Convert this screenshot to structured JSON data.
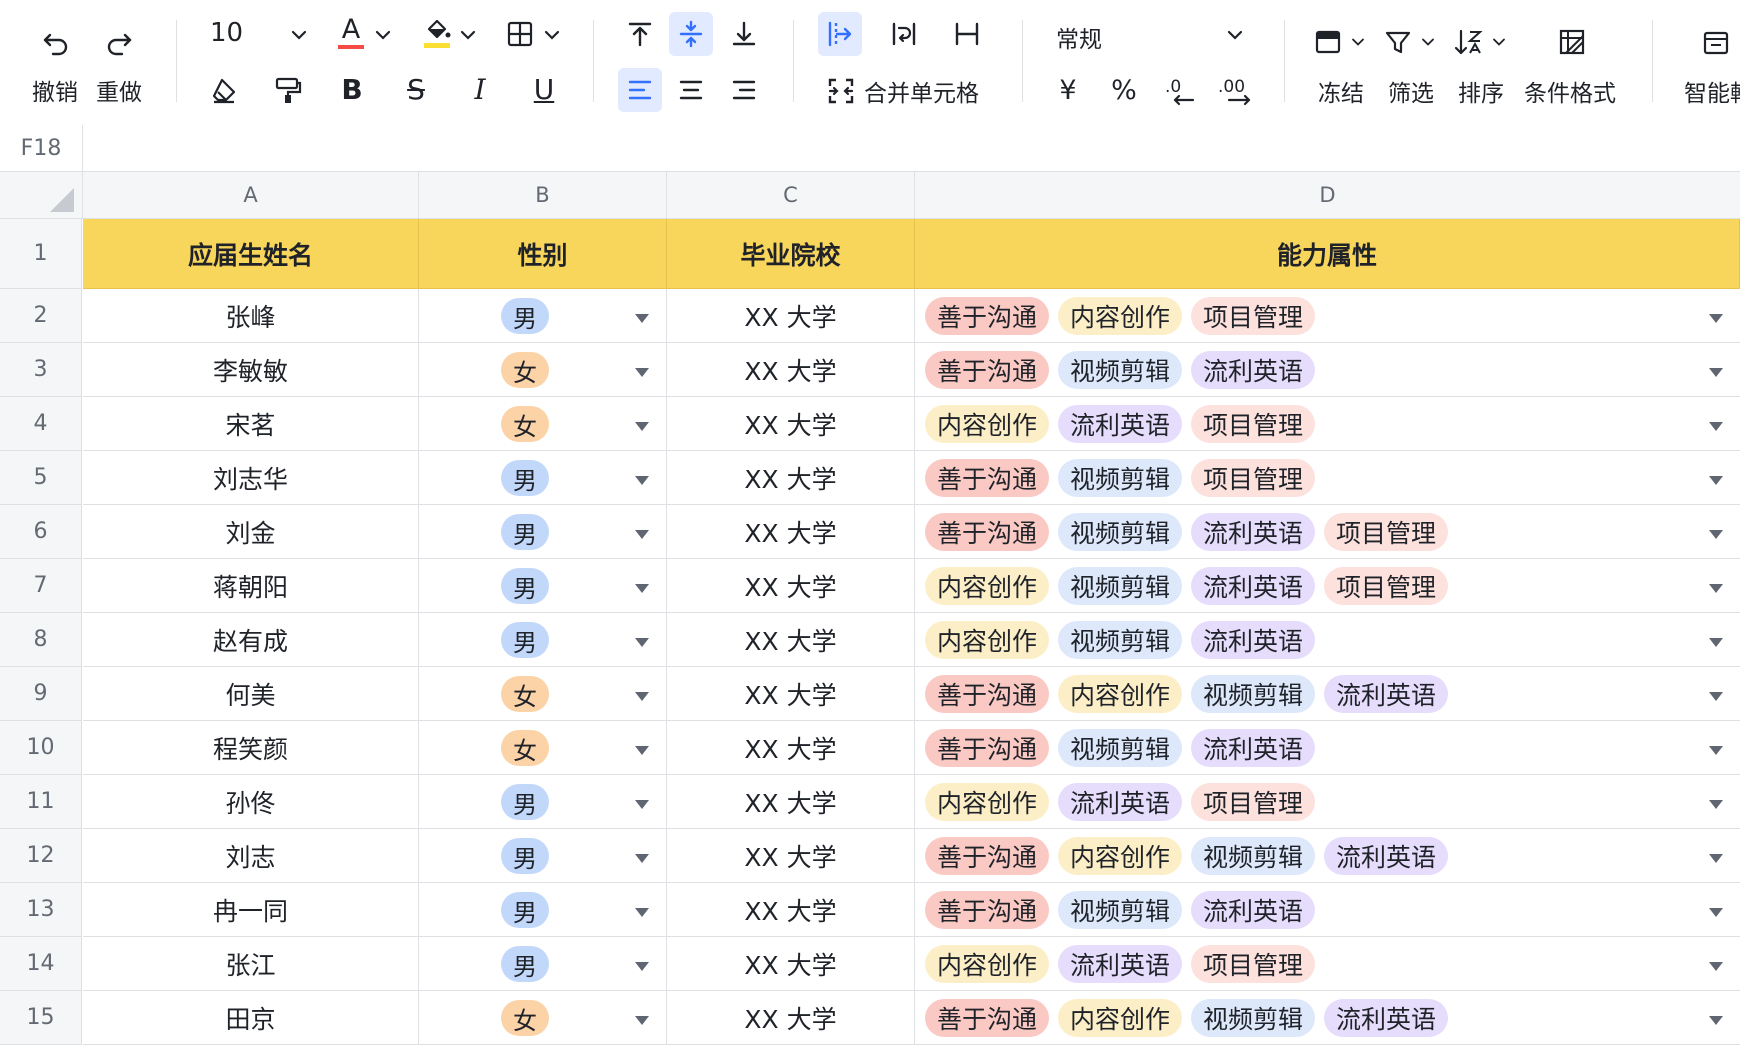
{
  "toolbar": {
    "undo_label": "撤销",
    "redo_label": "重做",
    "font_size": "10",
    "merge_label": "合并单元格",
    "number_format": "常规",
    "currency_symbol": "¥",
    "percent_symbol": "%",
    "freeze_label": "冻结",
    "filter_label": "筛选",
    "sort_label": "排序",
    "cond_format_label": "条件格式",
    "smart_label": "智能輔",
    "bold_glyph": "B",
    "italic_glyph": "I",
    "underline_glyph": "U",
    "strike_glyph": "S",
    "font_color_glyph": "A",
    "decimal_dec_glyph": ".0",
    "decimal_inc_glyph": ".00"
  },
  "name_box": "F18",
  "columns": [
    "A",
    "B",
    "C",
    "D"
  ],
  "header": [
    "应届生姓名",
    "性别",
    "毕业院校",
    "能力属性"
  ],
  "colors": {
    "header_bg": "#f8d55b",
    "male": "#c2d8fb",
    "female": "#fbd3a6",
    "tag_善于沟通": "#fbc9c3",
    "tag_内容创作": "#fcefc7",
    "tag_视频剪辑": "#dde8fb",
    "tag_流利英语": "#e6dcfb",
    "tag_项目管理": "#fce1dd",
    "accent": "#3370ff"
  },
  "rows": [
    {
      "num": "1"
    },
    {
      "num": "2",
      "name": "张峰",
      "gender": "男",
      "school": "XX 大学",
      "tags": [
        "善于沟通",
        "内容创作",
        "项目管理"
      ]
    },
    {
      "num": "3",
      "name": "李敏敏",
      "gender": "女",
      "school": "XX 大学",
      "tags": [
        "善于沟通",
        "视频剪辑",
        "流利英语"
      ]
    },
    {
      "num": "4",
      "name": "宋茗",
      "gender": "女",
      "school": "XX 大学",
      "tags": [
        "内容创作",
        "流利英语",
        "项目管理"
      ]
    },
    {
      "num": "5",
      "name": "刘志华",
      "gender": "男",
      "school": "XX 大学",
      "tags": [
        "善于沟通",
        "视频剪辑",
        "项目管理"
      ]
    },
    {
      "num": "6",
      "name": "刘金",
      "gender": "男",
      "school": "XX 大学",
      "tags": [
        "善于沟通",
        "视频剪辑",
        "流利英语",
        "项目管理"
      ]
    },
    {
      "num": "7",
      "name": "蒋朝阳",
      "gender": "男",
      "school": "XX 大学",
      "tags": [
        "内容创作",
        "视频剪辑",
        "流利英语",
        "项目管理"
      ]
    },
    {
      "num": "8",
      "name": "赵有成",
      "gender": "男",
      "school": "XX 大学",
      "tags": [
        "内容创作",
        "视频剪辑",
        "流利英语"
      ]
    },
    {
      "num": "9",
      "name": "何美",
      "gender": "女",
      "school": "XX 大学",
      "tags": [
        "善于沟通",
        "内容创作",
        "视频剪辑",
        "流利英语"
      ]
    },
    {
      "num": "10",
      "name": "程笑颜",
      "gender": "女",
      "school": "XX 大学",
      "tags": [
        "善于沟通",
        "视频剪辑",
        "流利英语"
      ]
    },
    {
      "num": "11",
      "name": "孙佟",
      "gender": "男",
      "school": "XX 大学",
      "tags": [
        "内容创作",
        "流利英语",
        "项目管理"
      ]
    },
    {
      "num": "12",
      "name": "刘志",
      "gender": "男",
      "school": "XX 大学",
      "tags": [
        "善于沟通",
        "内容创作",
        "视频剪辑",
        "流利英语"
      ]
    },
    {
      "num": "13",
      "name": "冉一同",
      "gender": "男",
      "school": "XX 大学",
      "tags": [
        "善于沟通",
        "视频剪辑",
        "流利英语"
      ]
    },
    {
      "num": "14",
      "name": "张江",
      "gender": "男",
      "school": "XX 大学",
      "tags": [
        "内容创作",
        "流利英语",
        "项目管理"
      ]
    },
    {
      "num": "15",
      "name": "田京",
      "gender": "女",
      "school": "XX 大学",
      "tags": [
        "善于沟通",
        "内容创作",
        "视频剪辑",
        "流利英语"
      ]
    }
  ]
}
